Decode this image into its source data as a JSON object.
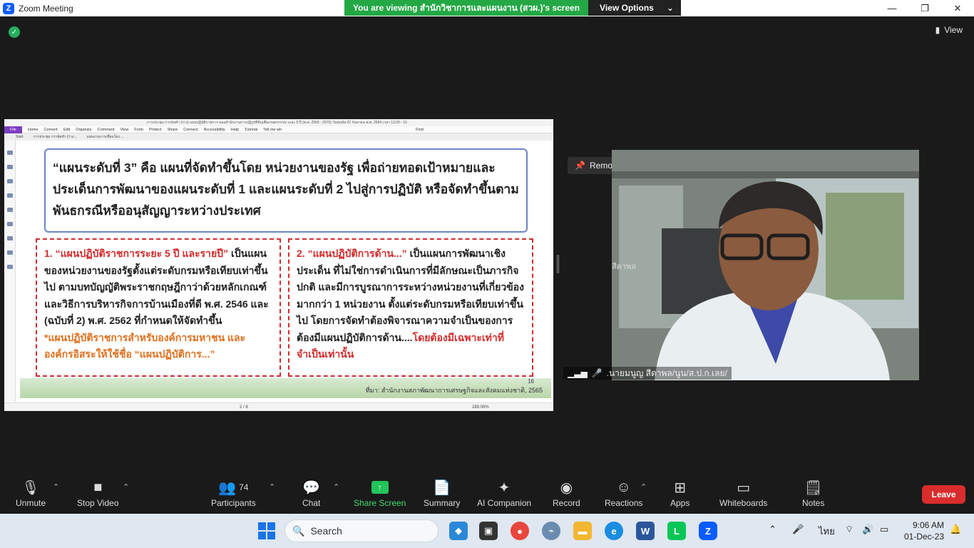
{
  "window": {
    "title": "Zoom Meeting",
    "minimize": "—",
    "maximize": "❐",
    "close": "✕"
  },
  "banner": {
    "message": "You are viewing สำนักวิชาการและแผนงาน (สวผ.)'s screen",
    "options_label": "View Options",
    "options_caret": "⌄"
  },
  "view_button": {
    "label": "View"
  },
  "shared_doc": {
    "title_bar": "การประชุม การจัดทำ (ร่าง) แผนปฏิบัติราชการ ของสำนักงานการปฏิรูปที่ดินเพื่อเกษตรกรรม ระยะ 5 ปี (พ.ศ. 2566 - 2570) วันพฤหัส 22 กันยายน พ.ศ. 2564 เวลา 13.00 - 16",
    "menu": [
      "File",
      "Home",
      "Convert",
      "Edit",
      "Organize",
      "Comment",
      "View",
      "Form",
      "Protect",
      "Share",
      "Connect",
      "Accessibility",
      "Help",
      "Tutorial",
      "Tell me wh"
    ],
    "find_placeholder": "Find",
    "tabs": [
      "Start",
      "การประชุม การจัดทำ (ร่าง...",
      "แผนงานการเชื่อมโยง ..."
    ],
    "heading": "“แผนระดับที่ 3” คือ แผนที่จัดทำขึ้นโดย หน่วยงานของรัฐ เพื่อถ่ายทอดเป้าหมายและประเด็นการพัฒนาของแผนระดับที่ 1 และแผนระดับที่ 2 ไปสู่การปฏิบัติ หรือจัดทำขึ้นตามพันธกรณีหรืออนุสัญญาระหว่างประเทศ",
    "left_box": {
      "title": "1. “แผนปฏิบัติราชการระยะ 5 ปี และรายปี”",
      "body": " เป็นแผนของหน่วยงานของรัฐตั้งแต่ระดับกรมหรือเทียบเท่าขึ้นไป ตามบทบัญญัติพระราชกฤษฎีกาว่าด้วยหลักเกณฑ์และวิธีการบริหารกิจการบ้านเมืองที่ดี พ.ศ. 2546 และ (ฉบับที่ 2) พ.ศ. 2562 ที่กำหนดให้จัดทำขึ้น",
      "note": "*แผนปฏิบัติราชการสำหรับองค์การมหาชน และองค์กรอิสระให้ใช้ชื่อ “แผนปฏิบัติการ...”"
    },
    "right_box": {
      "title": "2. “แผนปฏิบัติการด้าน...”",
      "body": " เป็นแผนการพัฒนาเชิงประเด็น ที่ไม่ใช่การดำเนินการที่มีลักษณะเป็นภารกิจปกติ และมีการบูรณาการระหว่างหน่วยงานที่เกี่ยวข้องมากกว่า 1 หน่วยงาน ตั้งแต่ระดับกรมหรือเทียบเท่าขึ้นไป โดยการจัดทำต้องพิจารณาความจำเป็นของการต้องมีแผนปฏิบัติการด้าน....",
      "emphasis": "โดยต้องมีเฉพาะเท่าที่จำเป็นเท่านั้น"
    },
    "page_number": "16",
    "source": "ที่มา: สำนักงานสภาพัฒนาการเศรษฐกิจและสังคมแห่งชาติ, 2565",
    "status_page": "2 / 8",
    "zoom": "289.06%"
  },
  "video": {
    "remove_pin": "Remove Pin",
    "participant_name": ".นายมนูญ สีดาพล/นูน/ส.ป.ก.เลย/",
    "wall_text": "สีดาพล"
  },
  "toolbar": {
    "unmute": "Unmute",
    "stop_video": "Stop Video",
    "participants": "Participants",
    "participant_count": "74",
    "chat": "Chat",
    "share_screen": "Share Screen",
    "summary": "Summary",
    "ai_companion": "AI Companion",
    "record": "Record",
    "reactions": "Reactions",
    "apps": "Apps",
    "whiteboards": "Whiteboards",
    "notes": "Notes",
    "leave": "Leave"
  },
  "taskbar": {
    "search_label": "Search",
    "language": "ไทย",
    "time": "9:06 AM",
    "date": "01-Dec-23"
  },
  "colors": {
    "zoom_blue": "#0b5cff",
    "banner_green": "#23a845",
    "leave_red": "#d92d2d",
    "share_green": "#23c45a"
  }
}
